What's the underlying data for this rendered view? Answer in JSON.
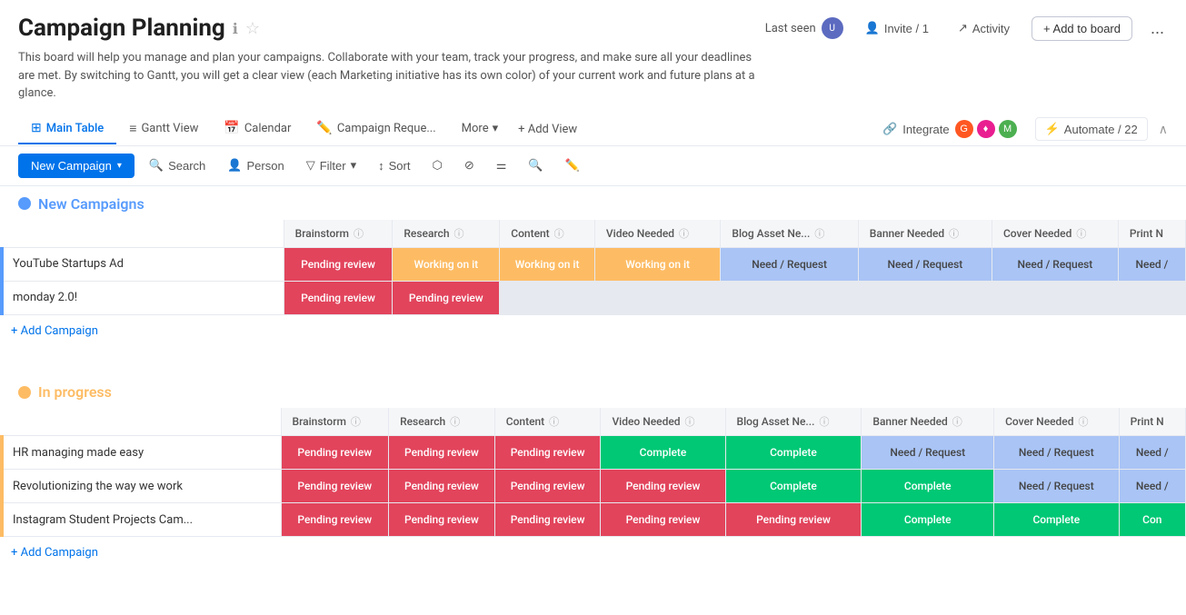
{
  "page": {
    "title": "Campaign Planning",
    "description": "This board will help you manage and plan your campaigns. Collaborate with your team, track your progress, and make sure all your deadlines are met. By switching to Gantt, you will get a clear view (each Marketing initiative has its own color) of your current work and future plans at a glance.",
    "last_seen_label": "Last seen",
    "invite_label": "Invite / 1",
    "activity_label": "Activity",
    "add_to_board_label": "+ Add to board",
    "more_label": "..."
  },
  "tabs": [
    {
      "id": "main-table",
      "label": "Main Table",
      "icon": "⊞",
      "active": true
    },
    {
      "id": "gantt-view",
      "label": "Gantt View",
      "icon": "≡",
      "active": false
    },
    {
      "id": "calendar",
      "label": "Calendar",
      "icon": "📅",
      "active": false
    },
    {
      "id": "campaign-reque",
      "label": "Campaign Reque...",
      "icon": "✏️",
      "active": false
    },
    {
      "id": "more",
      "label": "More",
      "active": false
    },
    {
      "id": "add-view",
      "label": "+ Add View",
      "active": false
    }
  ],
  "toolbar": {
    "new_campaign_label": "New Campaign",
    "search_label": "Search",
    "person_label": "Person",
    "filter_label": "Filter",
    "sort_label": "Sort",
    "integrate_label": "Integrate",
    "automate_label": "Automate / 22"
  },
  "groups": [
    {
      "id": "new-campaigns",
      "title": "New Campaigns",
      "color": "blue",
      "columns": [
        "Brainstorm",
        "Research",
        "Content",
        "Video Needed",
        "Blog Asset Ne...",
        "Banner Needed",
        "Cover Needed",
        "Print N"
      ],
      "rows": [
        {
          "name": "YouTube Startups Ad",
          "cells": [
            {
              "label": "Pending review",
              "type": "pending-review"
            },
            {
              "label": "Working on it",
              "type": "working-on-it"
            },
            {
              "label": "Working on it",
              "type": "working-on-it"
            },
            {
              "label": "Working on it",
              "type": "working-on-it"
            },
            {
              "label": "Need / Request",
              "type": "need-request"
            },
            {
              "label": "Need / Request",
              "type": "need-request"
            },
            {
              "label": "Need / Request",
              "type": "need-request"
            },
            {
              "label": "Need /",
              "type": "need-request"
            }
          ]
        },
        {
          "name": "monday 2.0!",
          "cells": [
            {
              "label": "Pending review",
              "type": "pending-review"
            },
            {
              "label": "Pending review",
              "type": "pending-review"
            },
            {
              "label": "",
              "type": "empty"
            },
            {
              "label": "",
              "type": "empty"
            },
            {
              "label": "",
              "type": "empty"
            },
            {
              "label": "",
              "type": "empty"
            },
            {
              "label": "",
              "type": "empty"
            },
            {
              "label": "",
              "type": "empty"
            }
          ]
        }
      ],
      "add_label": "+ Add Campaign"
    },
    {
      "id": "in-progress",
      "title": "In progress",
      "color": "orange",
      "columns": [
        "Brainstorm",
        "Research",
        "Content",
        "Video Needed",
        "Blog Asset Ne...",
        "Banner Needed",
        "Cover Needed",
        "Print N"
      ],
      "rows": [
        {
          "name": "HR managing made easy",
          "cells": [
            {
              "label": "Pending review",
              "type": "pending-review"
            },
            {
              "label": "Pending review",
              "type": "pending-review"
            },
            {
              "label": "Pending review",
              "type": "pending-review"
            },
            {
              "label": "Complete",
              "type": "complete"
            },
            {
              "label": "Complete",
              "type": "complete"
            },
            {
              "label": "Need / Request",
              "type": "need-request"
            },
            {
              "label": "Need / Request",
              "type": "need-request"
            },
            {
              "label": "Need /",
              "type": "need-request"
            }
          ]
        },
        {
          "name": "Revolutionizing the way we work",
          "cells": [
            {
              "label": "Pending review",
              "type": "pending-review"
            },
            {
              "label": "Pending review",
              "type": "pending-review"
            },
            {
              "label": "Pending review",
              "type": "pending-review"
            },
            {
              "label": "Pending review",
              "type": "pending-review"
            },
            {
              "label": "Complete",
              "type": "complete"
            },
            {
              "label": "Complete",
              "type": "complete"
            },
            {
              "label": "Need / Request",
              "type": "need-request"
            },
            {
              "label": "Need /",
              "type": "need-request"
            }
          ]
        },
        {
          "name": "Instagram Student Projects Cam...",
          "cells": [
            {
              "label": "Pending review",
              "type": "pending-review"
            },
            {
              "label": "Pending review",
              "type": "pending-review"
            },
            {
              "label": "Pending review",
              "type": "pending-review"
            },
            {
              "label": "Pending review",
              "type": "pending-review"
            },
            {
              "label": "Pending review",
              "type": "pending-review"
            },
            {
              "label": "Complete",
              "type": "complete"
            },
            {
              "label": "Complete",
              "type": "complete"
            },
            {
              "label": "Con",
              "type": "complete"
            }
          ]
        }
      ],
      "add_label": "+ Add Campaign"
    }
  ]
}
